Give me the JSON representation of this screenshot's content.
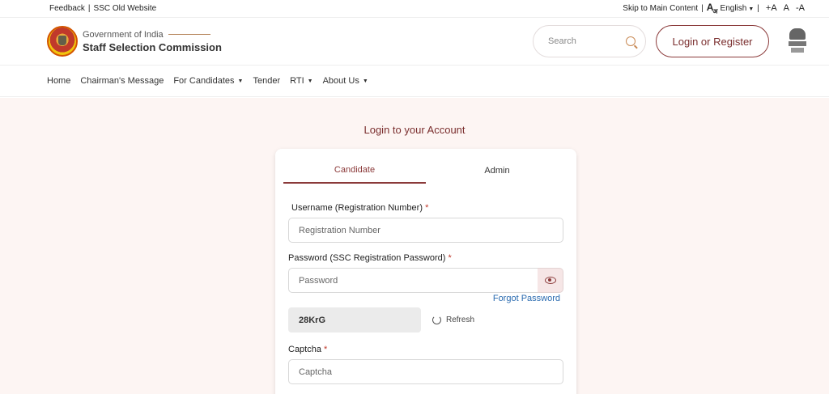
{
  "topbar": {
    "feedback": "Feedback",
    "old_website": "SSC Old Website",
    "skip": "Skip to Main Content",
    "lang_icon": "A",
    "lang_icon_sub": "अ",
    "language": "English",
    "font_increase": "+A",
    "font_normal": "A",
    "font_decrease": "-A"
  },
  "header": {
    "gov": "Government of India",
    "org": "Staff Selection Commission",
    "search_placeholder": "Search",
    "login_label": "Login or Register"
  },
  "nav": {
    "items": [
      {
        "label": "Home"
      },
      {
        "label": "Chairman's Message"
      },
      {
        "label": "For Candidates"
      },
      {
        "label": "Tender"
      },
      {
        "label": "RTI"
      },
      {
        "label": "About Us"
      }
    ]
  },
  "login": {
    "title": "Login to your Account",
    "tabs": [
      {
        "label": "Candidate"
      },
      {
        "label": "Admin"
      }
    ],
    "username_label": "Username (Registration Number)",
    "username_placeholder": "Registration Number",
    "password_label": "Password (SSC Registration Password)",
    "password_placeholder": "Password",
    "forgot": "Forgot Password",
    "captcha_code": "28KrG",
    "refresh": "Refresh",
    "captcha_label": "Captcha",
    "captcha_placeholder": "Captcha",
    "required_mark": "*"
  },
  "colors": {
    "brand": "#8b3a3a",
    "link": "#2a6bb0",
    "background": "#fdf5f3"
  }
}
